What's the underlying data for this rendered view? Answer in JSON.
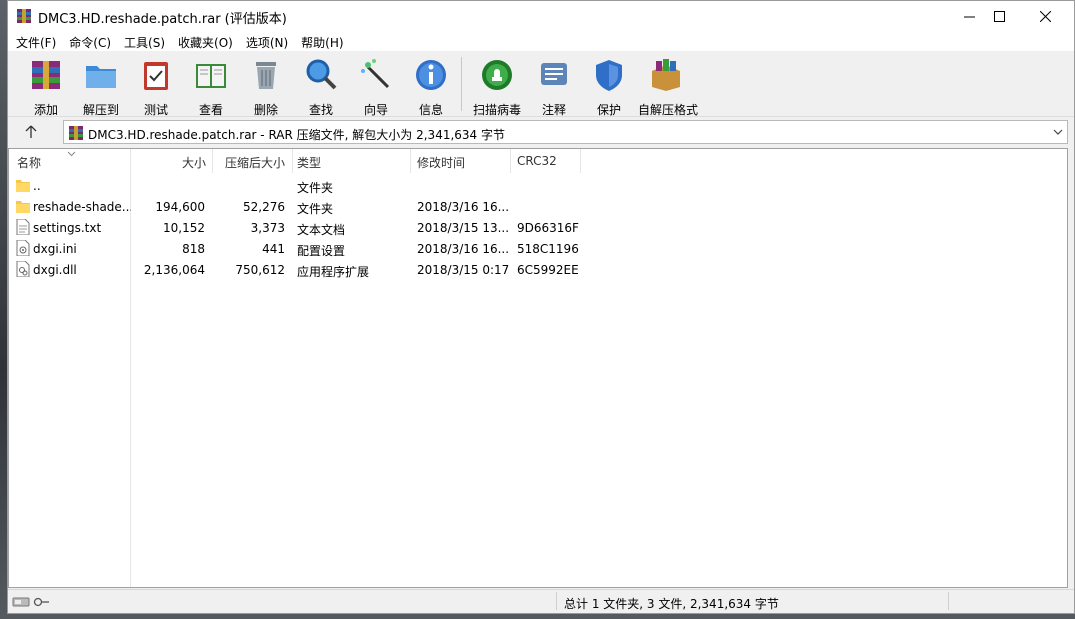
{
  "window": {
    "title": "DMC3.HD.reshade.patch.rar (评估版本)",
    "controls": {
      "minimize": "minimize",
      "maximize": "maximize",
      "close": "close"
    }
  },
  "menu": [
    "文件(F)",
    "命令(C)",
    "工具(S)",
    "收藏夹(O)",
    "选项(N)",
    "帮助(H)"
  ],
  "toolbar": [
    {
      "label": "添加",
      "icon": "add-archive-icon"
    },
    {
      "label": "解压到",
      "icon": "extract-to-folder-icon"
    },
    {
      "label": "测试",
      "icon": "test-clipboard-icon"
    },
    {
      "label": "查看",
      "icon": "view-book-icon"
    },
    {
      "label": "删除",
      "icon": "trash-icon"
    },
    {
      "label": "查找",
      "icon": "magnifier-icon"
    },
    {
      "label": "向导",
      "icon": "magic-wand-icon"
    },
    {
      "label": "信息",
      "icon": "info-icon"
    },
    {
      "label": "扫描病毒",
      "icon": "virus-scan-icon"
    },
    {
      "label": "注释",
      "icon": "comment-icon"
    },
    {
      "label": "保护",
      "icon": "shield-icon"
    },
    {
      "label": "自解压格式",
      "icon": "sfx-box-icon"
    }
  ],
  "address": {
    "path": "DMC3.HD.reshade.patch.rar - RAR 压缩文件, 解包大小为 2,341,634 字节"
  },
  "columns": {
    "name": "名称",
    "size": "大小",
    "packed": "压缩后大小",
    "type": "类型",
    "modified": "修改时间",
    "crc": "CRC32"
  },
  "files": [
    {
      "name": "..",
      "size": "",
      "packed": "",
      "type": "文件夹",
      "modified": "",
      "crc": "",
      "icon": "folder-icon"
    },
    {
      "name": "reshade-shade...",
      "size": "194,600",
      "packed": "52,276",
      "type": "文件夹",
      "modified": "2018/3/16 16...",
      "crc": "",
      "icon": "folder-icon"
    },
    {
      "name": "settings.txt",
      "size": "10,152",
      "packed": "3,373",
      "type": "文本文档",
      "modified": "2018/3/15 13...",
      "crc": "9D66316F",
      "icon": "text-file-icon"
    },
    {
      "name": "dxgi.ini",
      "size": "818",
      "packed": "441",
      "type": "配置设置",
      "modified": "2018/3/16 16...",
      "crc": "518C1196",
      "icon": "settings-file-icon"
    },
    {
      "name": "dxgi.dll",
      "size": "2,136,064",
      "packed": "750,612",
      "type": "应用程序扩展",
      "modified": "2018/3/15 0:17",
      "crc": "6C5992EE",
      "icon": "dll-file-icon"
    }
  ],
  "status": {
    "summary": "总计 1 文件夹, 3 文件, 2,341,634 字节"
  }
}
